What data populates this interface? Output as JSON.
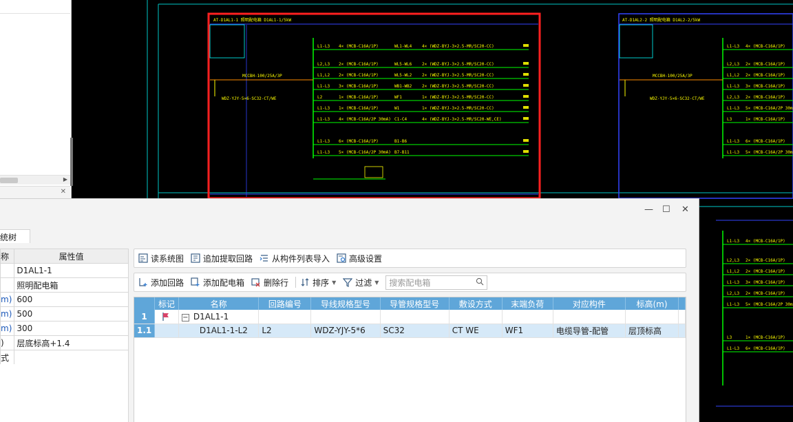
{
  "dialog": {
    "window_controls": {
      "minimize": "—",
      "maximize": "☐",
      "close": "✕"
    },
    "left_tab_label": "系统树",
    "properties": {
      "header": {
        "name_col": "称",
        "value_col": "属性值"
      },
      "rows": [
        {
          "key": "",
          "value": "D1AL1-1",
          "key_blue": false
        },
        {
          "key": "",
          "value": "照明配电箱",
          "key_blue": false
        },
        {
          "key": "m)",
          "value": "600",
          "key_blue": true
        },
        {
          "key": "m)",
          "value": "500",
          "key_blue": true
        },
        {
          "key": "m)",
          "value": "300",
          "key_blue": true
        },
        {
          "key": ")",
          "value": "层底标高+1.4",
          "key_blue": false
        },
        {
          "key": "式",
          "value": "",
          "key_blue": false
        }
      ]
    },
    "toolbar1": [
      {
        "icon": "read-system-diagram-icon",
        "label": "读系统图"
      },
      {
        "icon": "append-extract-circuit-icon",
        "label": "追加提取回路"
      },
      {
        "icon": "import-from-component-list-icon",
        "label": "从构件列表导入"
      },
      {
        "icon": "advanced-settings-icon",
        "label": "高级设置"
      }
    ],
    "toolbar2": {
      "add_circuit": "添加回路",
      "add_box": "添加配电箱",
      "delete_row": "删除行",
      "sort": "排序",
      "filter": "过滤",
      "search_placeholder": "搜索配电箱"
    },
    "grid": {
      "columns": [
        "标记",
        "名称",
        "回路编号",
        "导线规格型号",
        "导管规格型号",
        "敷设方式",
        "末端负荷",
        "对应构件",
        "标高(m)"
      ],
      "rows": [
        {
          "num": "1",
          "flag": true,
          "name": "D1AL1-1",
          "expander": "−",
          "circuit": "",
          "wire": "",
          "conduit": "",
          "laying": "",
          "load": "",
          "component": "",
          "elev": "",
          "selected": false
        },
        {
          "num": "1.1",
          "flag": false,
          "name": "D1AL1-1-L2",
          "expander": "",
          "circuit": "L2",
          "wire": "WDZ-YJY-5*6",
          "conduit": "SC32",
          "laying": "CT WE",
          "load": "WF1",
          "component": "电缆导管-配管",
          "elev": "层顶标高",
          "selected": true
        }
      ]
    }
  },
  "cad": {
    "left_box_title": "AT-D1AL1-1 照明配电箱 D1AL1-1/5kW",
    "right_box_title": "AT-D1AL2-2 照明配电箱 D1AL2-2/5kW",
    "left_circuits": [
      {
        "phase": "L1-L3",
        "breaker": "4× (MCB-C16A/1P)",
        "code": "WL1-WL4",
        "cable": "4× (WDZ-BYJ-3×2.5-MR/SC20-CC)"
      },
      {
        "phase": "L2,L3",
        "breaker": "2× (MCB-C16A/1P)",
        "code": "WL5-WL6",
        "cable": "2× (WDZ-BYJ-3×2.5-MR/SC20-CC)"
      },
      {
        "phase": "L1,L2",
        "breaker": "2× (MCB-C16A/1P)",
        "code": "WL5-WL2",
        "cable": "2× (WDZ-BYJ-3×2.5-MR/SC20-CC)"
      },
      {
        "phase": "L1-L3",
        "breaker": "3× (MCB-C16A/1P)",
        "code": "WB1-WB2",
        "cable": "2× (WDZ-BYJ-3×2.5-MR/SC20-CC)"
      },
      {
        "phase": "L2",
        "breaker": "1× (MCB-C16A/1P)",
        "code": "WF1",
        "cable": "1× (WDZ-BYJ-3×2.5-MR/SC20-CC)"
      },
      {
        "phase": "L1-L3",
        "breaker": "1× (MCB-C16A/1P)",
        "code": "W1",
        "cable": "1× (WDZ-BYJ-3×2.5-MR/SC20-CC)"
      },
      {
        "phase": "L1-L3",
        "breaker": "4× (MCB-C16A/2P 30mA)",
        "code": "C1-C4",
        "cable": "4× (WDZ-BYJ-3×2.5-MR/SC20-WE,CE)"
      },
      {
        "phase": "L1-L3",
        "breaker": "6× (MCB-C16A/1P)",
        "code": "B1-B6",
        "cable": ""
      },
      {
        "phase": "L1-L3",
        "breaker": "5× (MCB-C16A/2P 30mA)",
        "code": "B7-B11",
        "cable": ""
      }
    ],
    "right_circuits": [
      {
        "phase": "L1-L3",
        "breaker": "4× (MCB-C16A/1P)"
      },
      {
        "phase": "L2,L3",
        "breaker": "2× (MCB-C16A/1P)"
      },
      {
        "phase": "L1,L2",
        "breaker": "2× (MCB-C16A/1P)"
      },
      {
        "phase": "L1-L3",
        "breaker": "3× (MCB-C16A/1P)"
      },
      {
        "phase": "L2,L3",
        "breaker": "2× (MCB-C16A/1P)"
      },
      {
        "phase": "L1-L3",
        "breaker": "5× (MCB-C16A/2P 30mA)"
      },
      {
        "phase": "L3",
        "breaker": "1× (MCB-C16A/1P)"
      },
      {
        "phase": "L1-L3",
        "breaker": "6× (MCB-C16A/1P)"
      },
      {
        "phase": "L1-L3",
        "breaker": "5× (MCB-C16A/2P 30mA)"
      }
    ],
    "main_breaker": "MCCBH-100/25A/3P",
    "main_breaker_right": "MCCBH-100/25A/3P",
    "incoming_cable": "WDZ-YJY-5×6-SC32-CT/WE"
  }
}
